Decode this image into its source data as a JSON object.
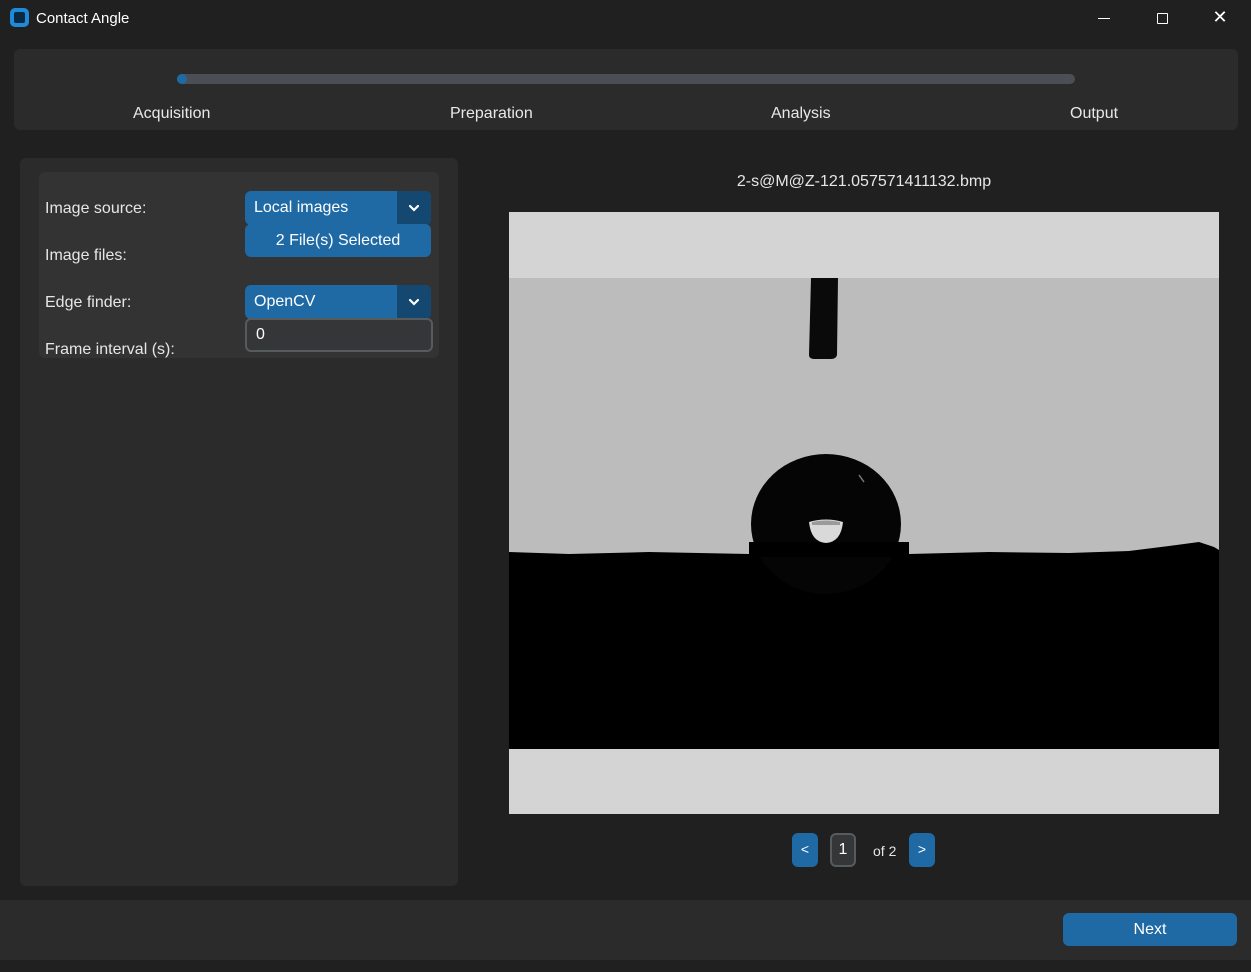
{
  "window": {
    "title": "Contact Angle",
    "minimize_icon": "minimize-icon",
    "maximize_icon": "maximize-icon",
    "close_icon": "close-icon",
    "close_glyph": "✕"
  },
  "stepper": {
    "progress": 0.01,
    "steps": [
      {
        "label": "Acquisition"
      },
      {
        "label": "Preparation"
      },
      {
        "label": "Analysis"
      },
      {
        "label": "Output"
      }
    ],
    "accent_color": "#1f6aa5"
  },
  "form": {
    "image_source": {
      "label": "Image source:",
      "value": "Local images"
    },
    "image_files": {
      "label": "Image files:",
      "button_label": "2 File(s) Selected"
    },
    "edge_finder": {
      "label": "Edge finder:",
      "value": "OpenCV"
    },
    "frame_interval": {
      "label": "Frame interval (s):",
      "value": "0"
    }
  },
  "preview": {
    "file_name": "2-s@M@Z-121.057571411132.bmp",
    "pager": {
      "prev_label": "<",
      "current_page": "1",
      "total_label": "of 2",
      "next_label": ">"
    }
  },
  "footer": {
    "next_label": "Next"
  }
}
